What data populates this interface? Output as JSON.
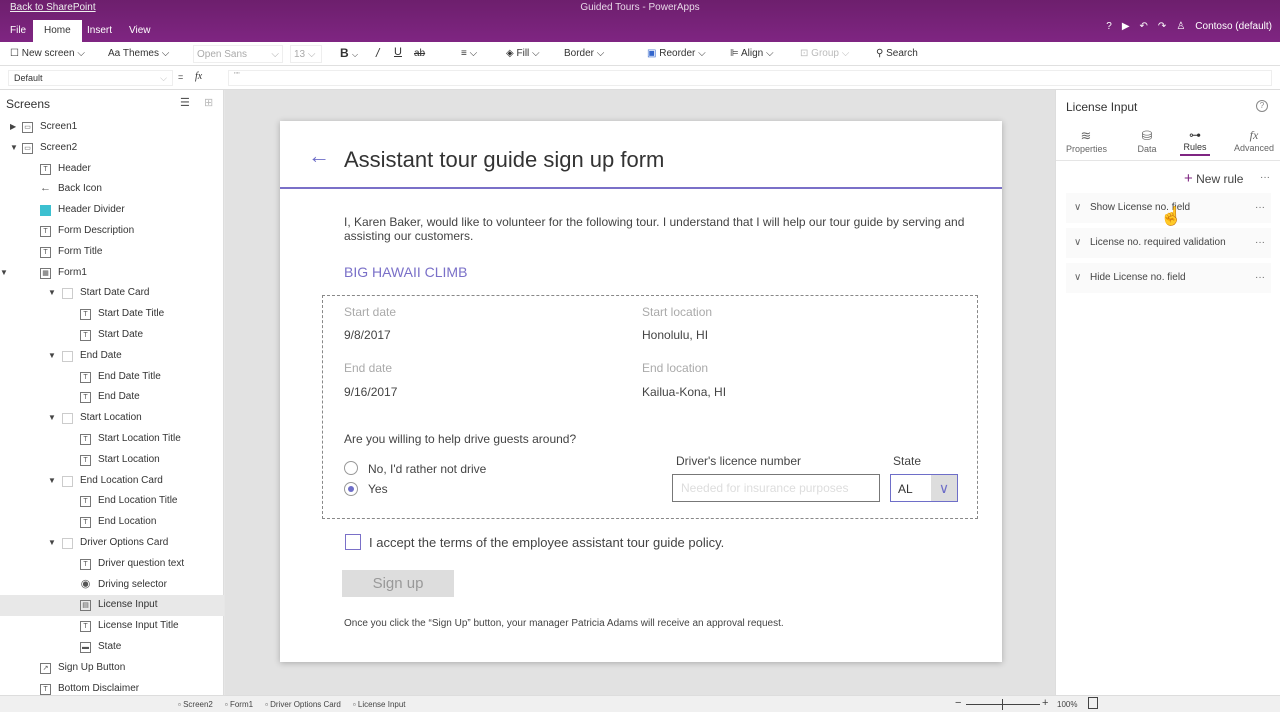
{
  "app": {
    "back_link": "Back to SharePoint",
    "title": "Guided Tours - PowerApps",
    "user": "Contoso (default)",
    "accent": "#7f2582"
  },
  "menu_tabs": [
    {
      "label": "File"
    },
    {
      "label": "Home",
      "active": true
    },
    {
      "label": "Insert"
    },
    {
      "label": "View"
    }
  ],
  "ribbon": {
    "new_screen": "New screen",
    "themes": "Themes",
    "font": "Open Sans",
    "font_size": "13",
    "fill": "Fill",
    "border": "Border",
    "reorder": "Reorder",
    "align": "Align",
    "group": "Group",
    "search": "Search"
  },
  "formula": {
    "property": "Default",
    "eq": "=",
    "fx": "fx",
    "value": "\"\""
  },
  "left_panel": {
    "title": "Screens",
    "tree": [
      {
        "label": "Screen1",
        "level": 0,
        "arrow": "collapsed",
        "icon": "screen"
      },
      {
        "label": "Screen2",
        "level": 0,
        "arrow": "expanded",
        "icon": "screen"
      },
      {
        "label": "Header",
        "level": 1,
        "icon": "label"
      },
      {
        "label": "Back Icon",
        "level": 1,
        "icon": "arrow"
      },
      {
        "label": "Header Divider",
        "level": 1,
        "icon": "rectangle"
      },
      {
        "label": "Form Description",
        "level": 1,
        "icon": "label"
      },
      {
        "label": "Form Title",
        "level": 1,
        "icon": "label"
      },
      {
        "label": "Form1",
        "level": 1,
        "arrow": "expanded",
        "icon": "form"
      },
      {
        "label": "Start Date Card",
        "level": 2,
        "arrow": "expanded",
        "icon": "card"
      },
      {
        "label": "Start Date Title",
        "level": 3,
        "icon": "label"
      },
      {
        "label": "Start Date",
        "level": 3,
        "icon": "label"
      },
      {
        "label": "End Date",
        "level": 2,
        "arrow": "expanded",
        "icon": "card"
      },
      {
        "label": "End Date Title",
        "level": 3,
        "icon": "label"
      },
      {
        "label": "End Date",
        "level": 3,
        "icon": "label"
      },
      {
        "label": "Start Location",
        "level": 2,
        "arrow": "expanded",
        "icon": "card"
      },
      {
        "label": "Start Location Title",
        "level": 3,
        "icon": "label"
      },
      {
        "label": "Start Location",
        "level": 3,
        "icon": "label"
      },
      {
        "label": "End Location Card",
        "level": 2,
        "arrow": "expanded",
        "icon": "card"
      },
      {
        "label": "End Location Title",
        "level": 3,
        "icon": "label"
      },
      {
        "label": "End Location",
        "level": 3,
        "icon": "label"
      },
      {
        "label": "Driver Options Card",
        "level": 2,
        "arrow": "expanded",
        "icon": "card"
      },
      {
        "label": "Driver question text",
        "level": 3,
        "icon": "label"
      },
      {
        "label": "Driving selector",
        "level": 3,
        "icon": "radio"
      },
      {
        "label": "License Input",
        "level": 3,
        "icon": "input",
        "selected": true
      },
      {
        "label": "License Input Title",
        "level": 3,
        "icon": "label"
      },
      {
        "label": "State",
        "level": 3,
        "icon": "dropdown"
      },
      {
        "label": "Sign Up Button",
        "level": 1,
        "icon": "button"
      },
      {
        "label": "Bottom Disclaimer",
        "level": 1,
        "icon": "label"
      }
    ]
  },
  "form": {
    "title": "Assistant tour guide sign up form",
    "description": "I, Karen Baker, would like to volunteer for the following tour. I understand that I will help our tour guide by serving and assisting our customers.",
    "tour": "BIG HAWAII CLIMB",
    "start_date_label": "Start date",
    "start_date": "9/8/2017",
    "start_location_label": "Start location",
    "start_location": "Honolulu, HI",
    "end_date_label": "End date",
    "end_date": "9/16/2017",
    "end_location_label": "End location",
    "end_location": "Kailua-Kona, HI",
    "question": "Are you willing to help drive guests around?",
    "option_no": "No, I'd rather not drive",
    "option_yes": "Yes",
    "selected_option": "Yes",
    "license_label": "Driver's licence number",
    "license_placeholder": "Needed for insurance purposes",
    "state_label": "State",
    "state_value": "AL",
    "terms": "I accept the terms of the employee assistant tour guide policy.",
    "terms_checked": false,
    "signup": "Sign up",
    "disclaimer": "Once you click the “Sign Up” button, your manager Patricia Adams will receive an approval request."
  },
  "right_panel": {
    "title": "License Input",
    "tabs": [
      {
        "label": "Properties"
      },
      {
        "label": "Data"
      },
      {
        "label": "Rules",
        "active": true
      },
      {
        "label": "Advanced"
      }
    ],
    "new_rule": "New rule",
    "rules": [
      {
        "label": "Show License no. field"
      },
      {
        "label": "License no. required validation"
      },
      {
        "label": "Hide License no. field"
      }
    ]
  },
  "status": {
    "breadcrumbs": [
      "Screen2",
      "Form1",
      "Driver Options Card",
      "License Input"
    ],
    "zoom": "100%"
  }
}
